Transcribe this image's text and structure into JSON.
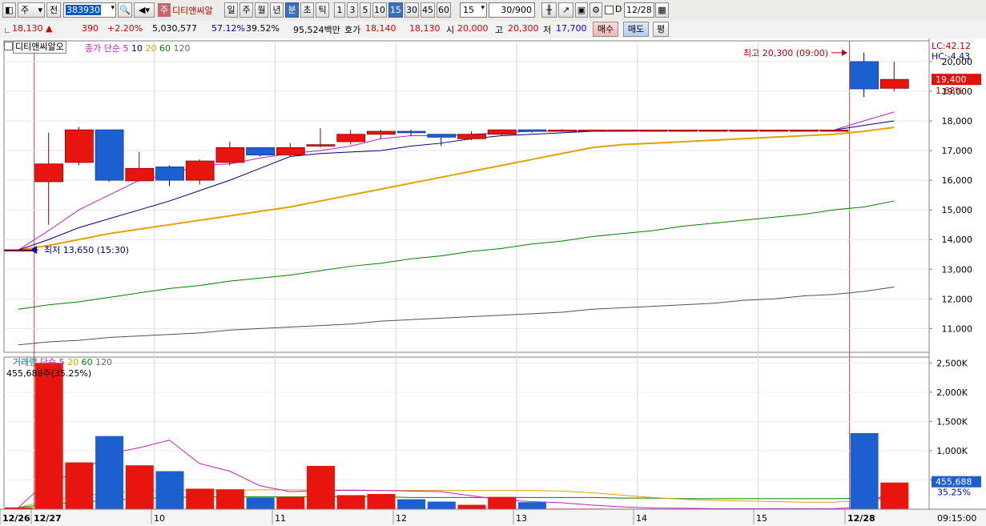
{
  "toolbar": {
    "market": "주",
    "prefix": "전",
    "code": "383930",
    "name_badge": "주",
    "name": "디티앤씨알",
    "periods": [
      "일",
      "주",
      "월",
      "년",
      "분",
      "초",
      "틱"
    ],
    "active_period": "분",
    "intervals": [
      "1",
      "3",
      "5",
      "10",
      "15",
      "30",
      "45",
      "60"
    ],
    "active_interval": "15",
    "interval_value": "15",
    "count": "30/900",
    "d_label": "D",
    "date": "12/28"
  },
  "quote": {
    "price": "18,130",
    "arrow": "▲",
    "change": "390",
    "change_pct": "+2.20%",
    "volume": "5,030,577",
    "ratio1": "57.12%",
    "ratio2": "39.52%",
    "amount": "95,524백만",
    "hoga_label": "호가",
    "ask": "18,140",
    "bid": "18,130",
    "open_label": "시",
    "open": "20,000",
    "high_label": "고",
    "high": "20,300",
    "low_label": "저",
    "low": "17,700",
    "buy_label": "매수",
    "sell_label": "매도",
    "eval_label": "평"
  },
  "price_panel": {
    "title": "디티앤씨알오",
    "legend_main": "종가 단순",
    "ma_labels": [
      "5",
      "10",
      "20",
      "60",
      "120"
    ],
    "lc": "LC:42.12",
    "hc": "HC:-4.43",
    "high_note": "최고 20,300 (09:00)",
    "low_note": "최저 13,650 (15:30)",
    "last_price": "19,400",
    "last_pct": "1.68%",
    "y_ticks": [
      "20,000",
      "19,000",
      "18,000",
      "17,000",
      "16,000",
      "15,000",
      "14,000",
      "13,000",
      "12,000",
      "11,000"
    ]
  },
  "volume_panel": {
    "title": "거래량",
    "legend_main": "단순",
    "ma_labels": [
      "5",
      "20",
      "60",
      "120"
    ],
    "last_info": "455,688주(35.25%)",
    "last_value": "455,688",
    "last_pct": "35.25%",
    "y_ticks": [
      "2,500K",
      "2,000K",
      "1,500K",
      "1,000K",
      "500K"
    ]
  },
  "x_axis": {
    "labels": [
      "12/26",
      "12/27",
      "10",
      "11",
      "12",
      "13",
      "14",
      "15",
      "12/28"
    ],
    "time": "09:15:00"
  },
  "colors": {
    "up": "#e8150f",
    "down": "#1c5fcf",
    "ma5": "#c020c0",
    "ma10": "#000080",
    "ma20": "#e8a000",
    "ma60": "#008000",
    "ma120": "#505050"
  },
  "chart_data": {
    "type": "candlestick",
    "y_range": [
      10200,
      20700
    ],
    "x": [
      "12/26 15:30",
      "12/27 09:00",
      "09:15",
      "09:30",
      "09:45",
      "10:00",
      "10:15",
      "10:30",
      "10:45",
      "11:00",
      "11:15",
      "11:30",
      "11:45",
      "12:00",
      "12:15",
      "12:30",
      "12:45",
      "13:00",
      "13:15",
      "13:30",
      "13:45",
      "14:00",
      "14:15",
      "14:30",
      "14:45",
      "15:00",
      "15:15",
      "15:30",
      "12/28 09:00",
      "09:15"
    ],
    "candles": [
      {
        "o": 13650,
        "h": 13650,
        "l": 13650,
        "c": 13650
      },
      {
        "o": 15950,
        "h": 17600,
        "l": 14500,
        "c": 16550
      },
      {
        "o": 16600,
        "h": 17800,
        "l": 16500,
        "c": 17700
      },
      {
        "o": 17700,
        "h": 17700,
        "l": 15950,
        "c": 16000
      },
      {
        "o": 15980,
        "h": 16950,
        "l": 15950,
        "c": 16400
      },
      {
        "o": 16450,
        "h": 16500,
        "l": 15800,
        "c": 16000
      },
      {
        "o": 16000,
        "h": 16700,
        "l": 15850,
        "c": 16650
      },
      {
        "o": 16600,
        "h": 17300,
        "l": 16500,
        "c": 17100
      },
      {
        "o": 17100,
        "h": 17100,
        "l": 16800,
        "c": 16850
      },
      {
        "o": 16850,
        "h": 17250,
        "l": 16800,
        "c": 17100
      },
      {
        "o": 17150,
        "h": 17750,
        "l": 17100,
        "c": 17200
      },
      {
        "o": 17300,
        "h": 17700,
        "l": 17200,
        "c": 17550
      },
      {
        "o": 17550,
        "h": 17700,
        "l": 17400,
        "c": 17650
      },
      {
        "o": 17650,
        "h": 17700,
        "l": 17500,
        "c": 17600
      },
      {
        "o": 17550,
        "h": 17550,
        "l": 17150,
        "c": 17450
      },
      {
        "o": 17400,
        "h": 17650,
        "l": 17350,
        "c": 17550
      },
      {
        "o": 17550,
        "h": 17700,
        "l": 17500,
        "c": 17700
      },
      {
        "o": 17700,
        "h": 17700,
        "l": 17600,
        "c": 17650
      },
      {
        "o": 17680,
        "h": 17720,
        "l": 17640,
        "c": 17690
      },
      {
        "o": 17690,
        "h": 17700,
        "l": 17670,
        "c": 17690
      },
      {
        "o": 17690,
        "h": 17700,
        "l": 17680,
        "c": 17690
      },
      {
        "o": 17690,
        "h": 17700,
        "l": 17680,
        "c": 17690
      },
      {
        "o": 17690,
        "h": 17700,
        "l": 17680,
        "c": 17690
      },
      {
        "o": 17690,
        "h": 17700,
        "l": 17680,
        "c": 17690
      },
      {
        "o": 17690,
        "h": 17700,
        "l": 17680,
        "c": 17690
      },
      {
        "o": 17690,
        "h": 17700,
        "l": 17680,
        "c": 17690
      },
      {
        "o": 17690,
        "h": 17700,
        "l": 17680,
        "c": 17690
      },
      {
        "o": 17690,
        "h": 17700,
        "l": 17680,
        "c": 17690
      },
      {
        "o": 20000,
        "h": 20300,
        "l": 18800,
        "c": 19080
      },
      {
        "o": 19100,
        "h": 20000,
        "l": 19000,
        "c": 19400
      }
    ],
    "ma": {
      "5": [
        13650,
        14300,
        15000,
        15500,
        16000,
        16200,
        16500,
        16550,
        16750,
        16900,
        17000,
        17150,
        17400,
        17500,
        17500,
        17550,
        17600,
        17650,
        17650,
        17680,
        17690,
        17690,
        17690,
        17690,
        17690,
        17690,
        17690,
        17690,
        18000,
        18300
      ],
      "10": [
        13650,
        14000,
        14400,
        14700,
        15000,
        15300,
        15650,
        16000,
        16400,
        16800,
        16900,
        16950,
        17000,
        17150,
        17250,
        17400,
        17500,
        17550,
        17600,
        17650,
        17660,
        17670,
        17680,
        17690,
        17690,
        17690,
        17690,
        17690,
        17850,
        18000
      ],
      "20": [
        13650,
        13800,
        14000,
        14200,
        14350,
        14500,
        14650,
        14800,
        14950,
        15100,
        15300,
        15500,
        15700,
        15900,
        16100,
        16300,
        16500,
        16700,
        16900,
        17100,
        17200,
        17250,
        17300,
        17350,
        17400,
        17450,
        17500,
        17550,
        17650,
        17780
      ],
      "60": [
        11650,
        11800,
        11900,
        12050,
        12200,
        12350,
        12450,
        12600,
        12700,
        12800,
        12950,
        13100,
        13200,
        13350,
        13450,
        13600,
        13700,
        13850,
        13950,
        14100,
        14200,
        14300,
        14450,
        14550,
        14650,
        14750,
        14850,
        15000,
        15100,
        15300
      ],
      "120": [
        10450,
        10550,
        10600,
        10700,
        10750,
        10800,
        10850,
        10950,
        11000,
        11050,
        11100,
        11150,
        11250,
        11300,
        11350,
        11400,
        11450,
        11500,
        11550,
        11650,
        11700,
        11750,
        11800,
        11850,
        11950,
        12000,
        12100,
        12150,
        12250,
        12400
      ]
    },
    "volume": {
      "values": [
        30000,
        2500000,
        800000,
        1250000,
        750000,
        650000,
        350000,
        340000,
        200000,
        210000,
        740000,
        240000,
        260000,
        170000,
        130000,
        75000,
        210000,
        120000,
        10000,
        10000,
        8000,
        8000,
        8000,
        8000,
        8000,
        8000,
        8000,
        8000,
        1300000,
        455688
      ],
      "ma5": [
        30000,
        500000,
        600000,
        950000,
        1050000,
        1180000,
        780000,
        650000,
        400000,
        300000,
        320000,
        320000,
        320000,
        310000,
        300000,
        230000,
        160000,
        130000,
        110000,
        70000,
        40000,
        20000,
        15000,
        10000,
        9000,
        8000,
        8000,
        10000,
        30000,
        360000
      ],
      "ma20": [
        30000,
        150000,
        220000,
        280000,
        310000,
        320000,
        320000,
        320000,
        330000,
        330000,
        330000,
        330000,
        320000,
        320000,
        320000,
        320000,
        320000,
        320000,
        310000,
        280000,
        240000,
        200000,
        170000,
        150000,
        140000,
        130000,
        120000,
        120000,
        150000,
        170000
      ],
      "ma60": [
        30000,
        80000,
        120000,
        150000,
        180000,
        200000,
        210000,
        210000,
        210000,
        210000,
        210000,
        210000,
        210000,
        200000,
        200000,
        200000,
        200000,
        200000,
        200000,
        200000,
        190000,
        190000,
        180000,
        180000,
        180000,
        180000,
        180000,
        180000,
        185000,
        190000
      ],
      "y_range": [
        0,
        2600000
      ]
    }
  }
}
